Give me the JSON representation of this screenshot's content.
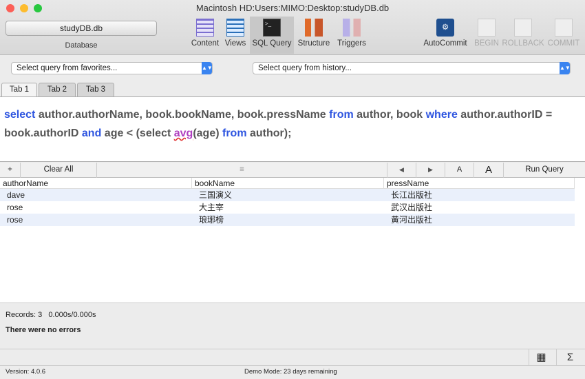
{
  "window": {
    "title": "Macintosh HD:Users:MIMO:Desktop:studyDB.db"
  },
  "toolbar": {
    "database": {
      "value": "studyDB.db",
      "label": "Database"
    },
    "items": [
      {
        "label": "Content"
      },
      {
        "label": "Views"
      },
      {
        "label": "SQL Query"
      },
      {
        "label": "Structure"
      },
      {
        "label": "Triggers"
      },
      {
        "label": "AutoCommit"
      },
      {
        "label": "BEGIN"
      },
      {
        "label": "ROLLBACK"
      },
      {
        "label": "COMMIT"
      }
    ]
  },
  "favorites": {
    "placeholder": "Select query from favorites..."
  },
  "history": {
    "placeholder": "Select query from history..."
  },
  "tabs": [
    {
      "label": "Tab 1"
    },
    {
      "label": "Tab 2"
    },
    {
      "label": "Tab 3"
    }
  ],
  "editor": {
    "tokens": [
      {
        "t": "select",
        "k": "kw"
      },
      {
        "t": " author.authorName, book.bookName, book.pressName ",
        "k": ""
      },
      {
        "t": "from",
        "k": "kw"
      },
      {
        "t": " author, book ",
        "k": ""
      },
      {
        "t": "where",
        "k": "kw"
      },
      {
        "t": " author.authorID = book.authorID ",
        "k": ""
      },
      {
        "t": "and",
        "k": "kw"
      },
      {
        "t": " age < (select ",
        "k": ""
      },
      {
        "t": "avg",
        "k": "err"
      },
      {
        "t": "(age) ",
        "k": ""
      },
      {
        "t": "from",
        "k": "kw"
      },
      {
        "t": " author);",
        "k": ""
      }
    ]
  },
  "results_toolbar": {
    "add": "+",
    "clear_all": "Clear All",
    "menu": "≡",
    "back": "◀",
    "forward": "▶",
    "font_small": "A",
    "font_large": "A",
    "run_query": "Run Query"
  },
  "results": {
    "columns": [
      "authorName",
      "bookName",
      "pressName"
    ],
    "rows": [
      [
        "dave",
        "三国演义",
        "长江出版社"
      ],
      [
        "rose",
        "大主宰",
        "武汉出版社"
      ],
      [
        "rose",
        "琅琊榜",
        "黄河出版社"
      ]
    ]
  },
  "status": {
    "records": "Records: 3   0.000s/0.000s",
    "errors": "There were no errors"
  },
  "footer": {
    "version": "Version: 4.0.6",
    "demo": "Demo Mode: 23 days remaining",
    "grid_icon": "▦",
    "sigma": "Σ"
  }
}
